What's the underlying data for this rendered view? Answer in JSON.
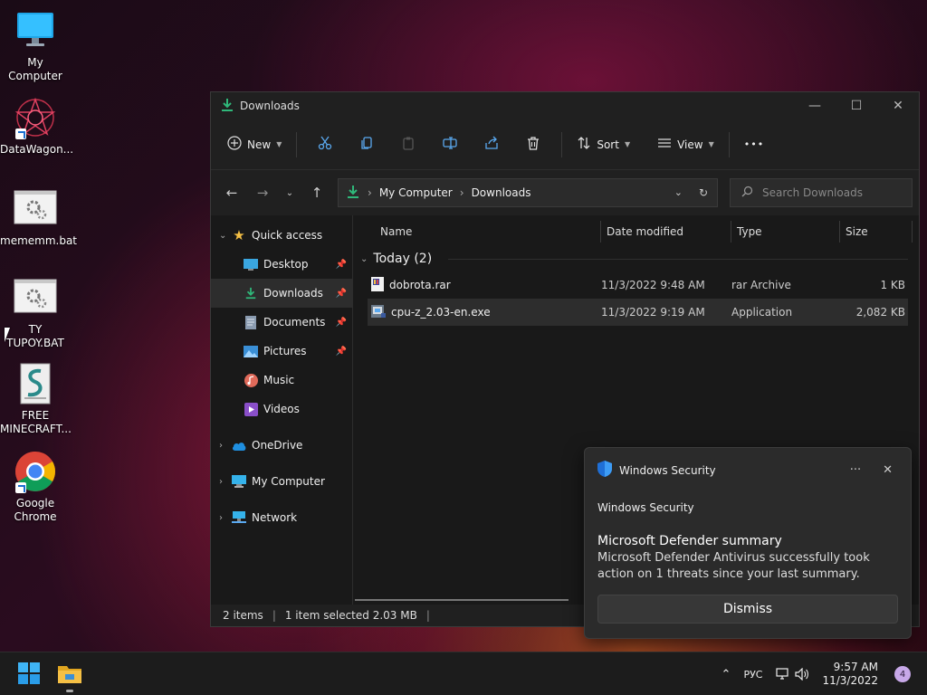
{
  "desktop": {
    "icons": [
      {
        "label": "My Computer"
      },
      {
        "label": "DataWagon..."
      },
      {
        "label": "mememm.bat"
      },
      {
        "label_line1": "TY",
        "label_line2": "TUPOY.BAT"
      },
      {
        "label_line1": "FREE",
        "label_line2": "MINECRAFT..."
      },
      {
        "label_line1": "Google",
        "label_line2": "Chrome"
      }
    ]
  },
  "window": {
    "title": "Downloads",
    "toolbar": {
      "new_label": "New",
      "sort_label": "Sort",
      "view_label": "View",
      "more_label": "•••"
    },
    "breadcrumb": {
      "root": "My Computer",
      "current": "Downloads"
    },
    "search": {
      "placeholder": "Search Downloads"
    },
    "nav": {
      "quick_access": "Quick access",
      "items": [
        {
          "label": "Desktop"
        },
        {
          "label": "Downloads"
        },
        {
          "label": "Documents"
        },
        {
          "label": "Pictures"
        },
        {
          "label": "Music"
        },
        {
          "label": "Videos"
        }
      ],
      "onedrive": "OneDrive",
      "my_computer": "My Computer",
      "network": "Network"
    },
    "columns": {
      "name": "Name",
      "date": "Date modified",
      "type": "Type",
      "size": "Size"
    },
    "group": {
      "label": "Today (2)"
    },
    "files": [
      {
        "name": "dobrota.rar",
        "date": "11/3/2022 9:48 AM",
        "type": "rar Archive",
        "size": "1 KB"
      },
      {
        "name": "cpu-z_2.03-en.exe",
        "date": "11/3/2022 9:19 AM",
        "type": "Application",
        "size": "2,082 KB"
      }
    ],
    "status": {
      "items": "2 items",
      "selected": "1 item selected  2.03 MB",
      "sep": "|"
    }
  },
  "toast": {
    "app": "Windows Security",
    "more": "···",
    "close": "✕",
    "sub": "Windows Security",
    "title": "Microsoft Defender summary",
    "body": "Microsoft Defender Antivirus successfully took action on 1 threats since your last summary.",
    "button": "Dismiss"
  },
  "taskbar": {
    "lang": "РУС",
    "time": "9:57 AM",
    "date": "11/3/2022",
    "notifications": "4"
  },
  "colors": {
    "accent": "#0078d4",
    "folder": "#f5c045",
    "download_green": "#2fb87a"
  }
}
